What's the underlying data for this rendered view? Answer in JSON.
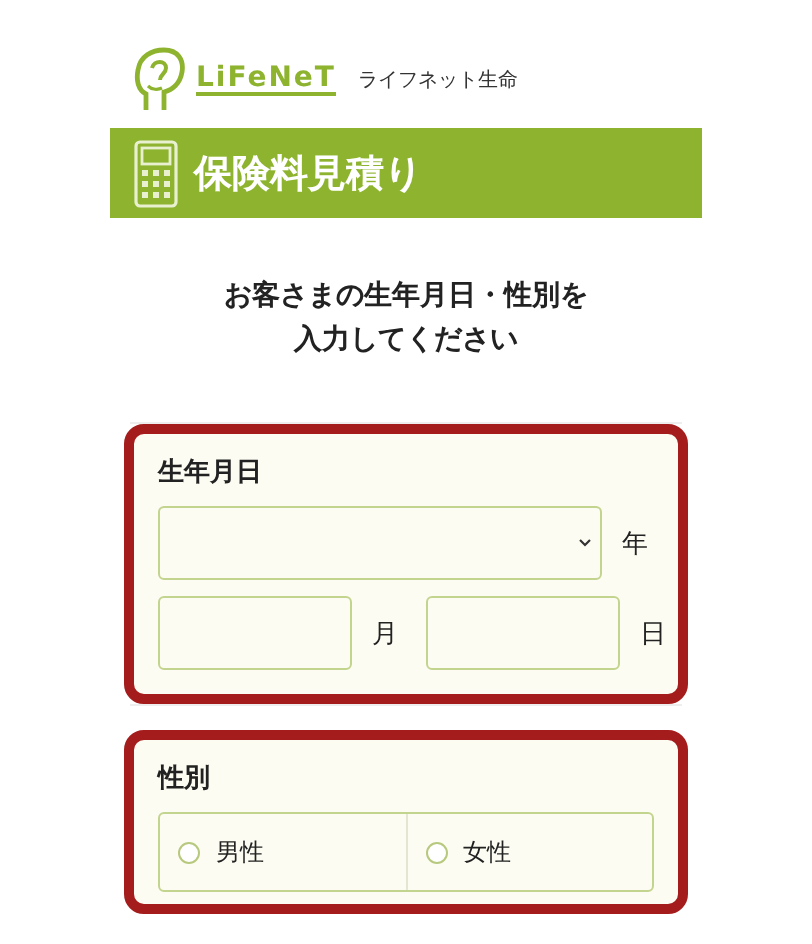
{
  "logo": {
    "brand": "LiFeNeT",
    "tagline": "ライフネット生命"
  },
  "banner": {
    "title": "保険料見積り"
  },
  "instruction": {
    "lines": [
      "お客さまの生年月日・性別を",
      "入力してください"
    ]
  },
  "birthdate": {
    "label": "生年月日",
    "year_unit": "年",
    "month_unit": "月",
    "day_unit": "日"
  },
  "gender": {
    "label": "性別",
    "options": [
      {
        "label": "男性",
        "selected": false
      },
      {
        "label": "女性",
        "selected": false
      }
    ]
  }
}
